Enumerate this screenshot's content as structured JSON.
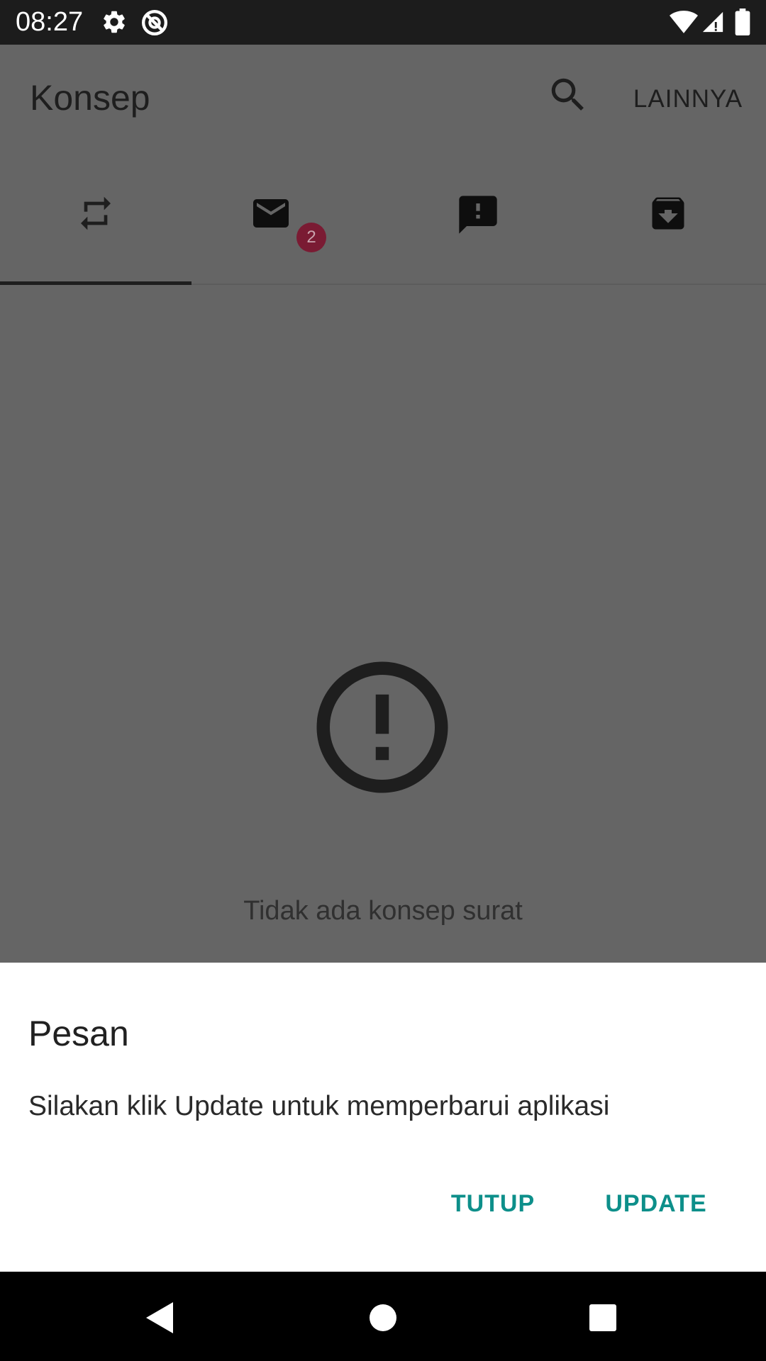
{
  "status_bar": {
    "time": "08:27",
    "icons": [
      "gear-icon",
      "sync-disabled-icon",
      "wifi-icon",
      "signal-icon",
      "battery-icon"
    ]
  },
  "toolbar": {
    "title": "Konsep",
    "search_icon": "search-icon",
    "more_label": "LAINNYA"
  },
  "tabs": [
    {
      "icon": "repeat-icon",
      "selected": true
    },
    {
      "icon": "mail-icon",
      "badge": "2"
    },
    {
      "icon": "feedback-icon"
    },
    {
      "icon": "archive-icon"
    }
  ],
  "empty_state": {
    "icon": "error-outline-icon",
    "text": "Tidak ada konsep surat"
  },
  "dialog": {
    "title": "Pesan",
    "message": "Silakan klik Update untuk memperbarui aplikasi",
    "buttons": {
      "close": "TUTUP",
      "update": "UPDATE"
    }
  },
  "colors": {
    "accent": "#0d8f8a",
    "badge": "#7a1b33",
    "scrim": "#656565"
  },
  "nav_bar": [
    "back-icon",
    "home-icon",
    "recents-icon"
  ]
}
